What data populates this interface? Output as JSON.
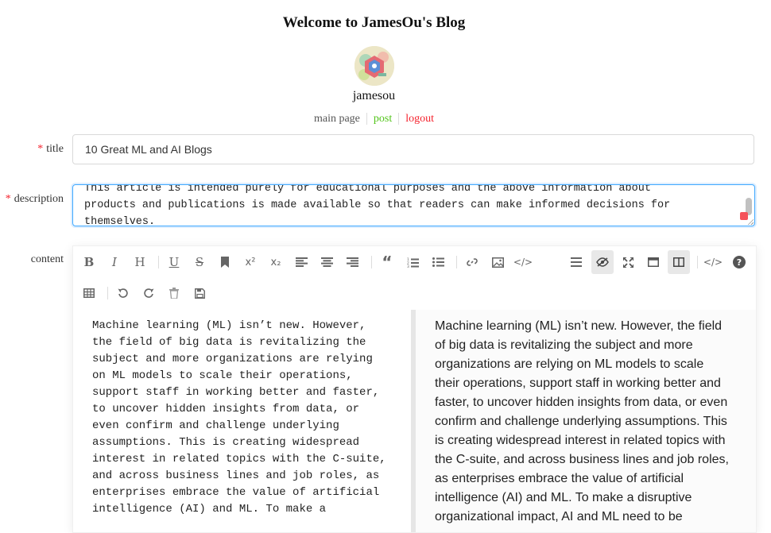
{
  "header": {
    "site_title": "Welcome to JamesOu's Blog",
    "username": "jamesou",
    "nav": [
      {
        "label": "main page",
        "color": "#555555"
      },
      {
        "label": "post",
        "color": "#52c41a"
      },
      {
        "label": "logout",
        "color": "#f5222d"
      }
    ]
  },
  "form": {
    "title_label": "title",
    "title_value": "10 Great ML and AI Blogs",
    "description_label": "description",
    "description_lines": [
      "This article is intended purely for educational purposes and the above information about",
      "products and publications is made available so that readers can make informed decisions for",
      "themselves."
    ],
    "content_label": "content",
    "required_mark": "*"
  },
  "toolbar": {
    "row1": [
      "bold-icon",
      "italic-icon",
      "header-icon",
      "underline-icon",
      "strikethrough-icon",
      "bookmark-icon",
      "superscript-icon",
      "subscript-icon",
      "align-left-icon",
      "align-center-icon",
      "align-right-icon",
      "quote-icon",
      "ordered-list-icon",
      "unordered-list-icon",
      "link-icon",
      "image-icon",
      "code-icon",
      "menu-icon",
      "eye-off-icon",
      "fullscreen-icon",
      "window-icon",
      "split-view-icon",
      "html-code-icon",
      "help-icon"
    ],
    "row2": [
      "table-icon",
      "undo-icon",
      "redo-icon",
      "trash-icon",
      "save-icon"
    ]
  },
  "editor": {
    "markdown_lines": [
      "Machine learning (ML) isn’t new. However,",
      "the field of big data is revitalizing the",
      "subject and more organizations are relying",
      "on ML models to scale their operations,",
      "support staff in working better and faster,",
      "to uncover hidden insights from data, or",
      "even confirm and challenge underlying",
      "assumptions. This is creating widespread",
      "interest in related topics with the C-suite,",
      "and across business lines and job roles, as",
      "enterprises embrace the value of artificial",
      "intelligence (AI) and ML. To make a"
    ],
    "preview_lines": [
      "Machine learning (ML) isn’t new. However, the field",
      "of big data is revitalizing the subject and more",
      "organizations are relying on ML models to scale",
      "their operations, support staff in working better and",
      "faster, to uncover hidden insights from data, or even",
      "confirm and challenge underlying assumptions. This",
      "is creating widespread interest in related topics with",
      "the C-suite, and across business lines and job roles,",
      "as enterprises embrace the value of artificial",
      "intelligence (AI) and ML. To make a disruptive",
      "organizational impact, AI and ML need to be"
    ]
  }
}
